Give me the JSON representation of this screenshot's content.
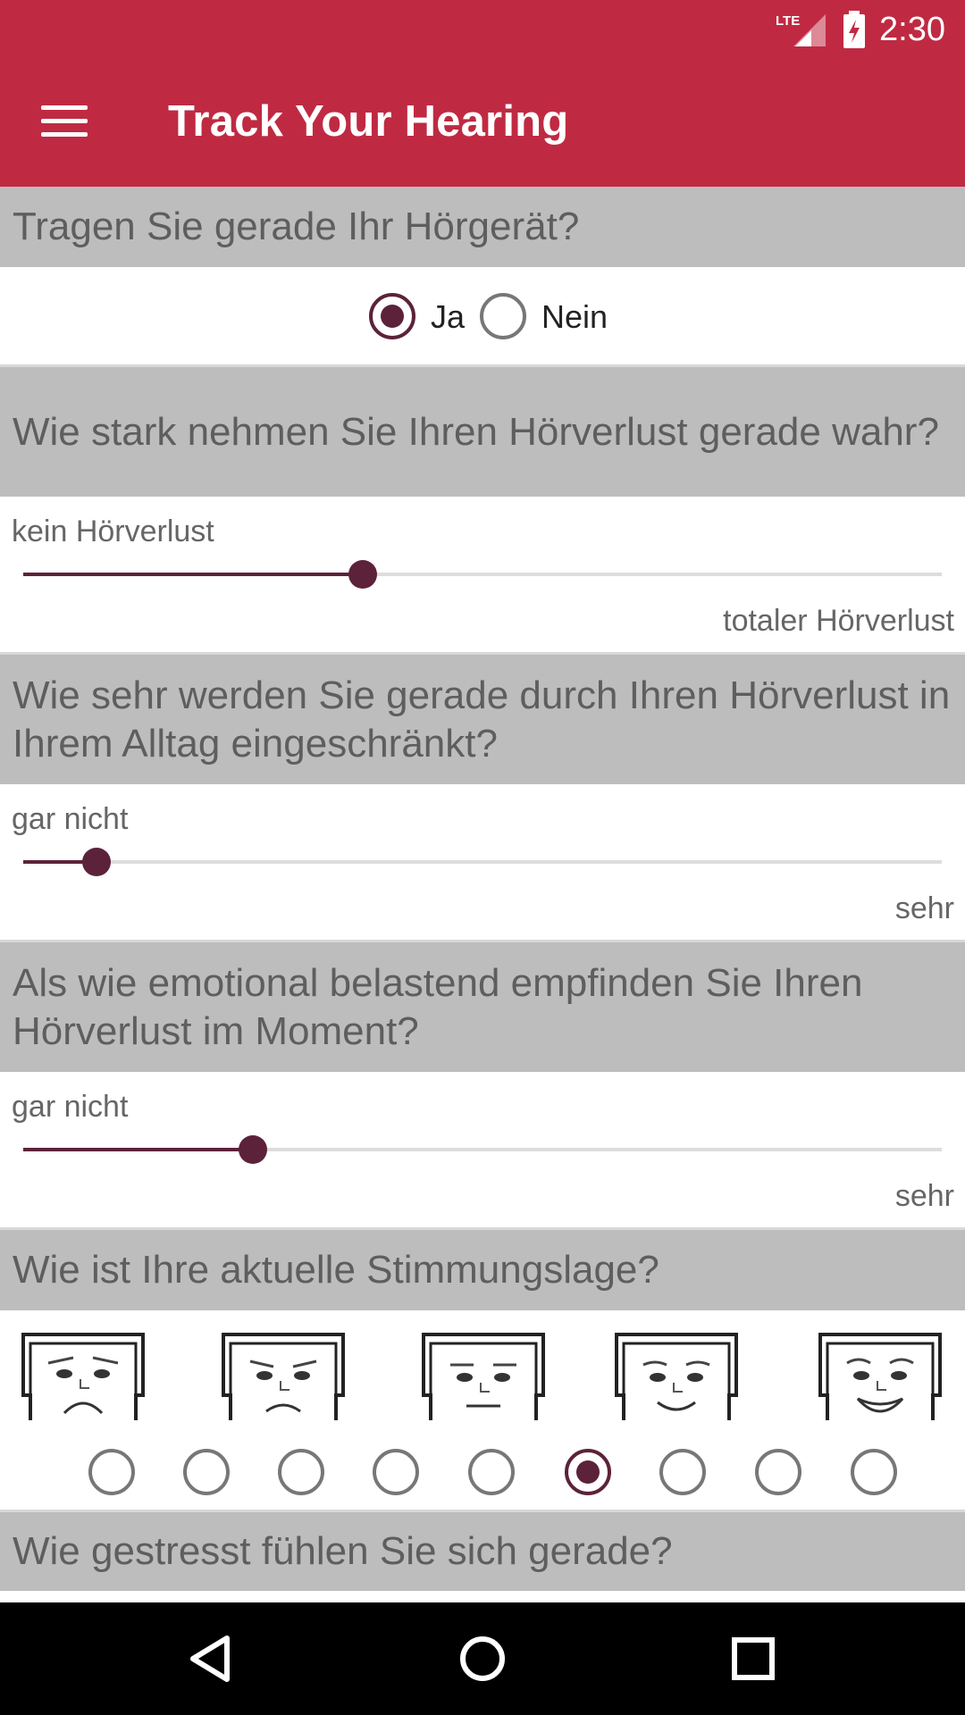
{
  "status_bar": {
    "network": "LTE",
    "time": "2:30"
  },
  "app_bar": {
    "title": "Track Your Hearing",
    "menu_icon": "hamburger-menu-icon"
  },
  "questions": {
    "hearing_aid": {
      "title": "Tragen Sie gerade Ihr Hörgerät?",
      "options": [
        "Ja",
        "Nein"
      ],
      "selected": "Ja"
    },
    "hearing_loss": {
      "title": "Wie stark nehmen Sie Ihren Hörverlust gerade wahr?",
      "min_label": "kein Hörverlust",
      "max_label": "totaler Hörverlust",
      "value": 0.37
    },
    "daily_limit": {
      "title": "Wie sehr werden Sie gerade durch Ihren Hörverlust in Ihrem Alltag eingeschränkt?",
      "min_label": "gar nicht",
      "max_label": "sehr",
      "value": 0.08
    },
    "emotional": {
      "title": "Als wie emotional belastend empfinden Sie Ihren Hörverlust im Moment?",
      "min_label": "gar nicht",
      "max_label": "sehr",
      "value": 0.25
    },
    "mood": {
      "title": "Wie ist Ihre aktuelle Stimmungslage?",
      "options_count": 9,
      "selected_index": 5
    },
    "stress": {
      "title": "Wie gestresst fühlen Sie sich gerade?"
    }
  },
  "colors": {
    "app_bar": "#bf2a42",
    "accent": "#5c2239",
    "section_header": "#bdbdbd"
  },
  "nav_bar": {
    "back_icon": "back-icon",
    "home_icon": "home-icon",
    "recents_icon": "recents-icon"
  }
}
